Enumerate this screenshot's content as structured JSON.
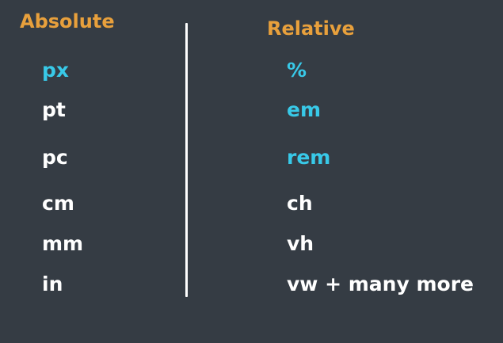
{
  "colors": {
    "background": "#353c44",
    "heading": "#e8a03c",
    "highlight": "#38c9e8",
    "text": "#ffffff"
  },
  "absolute": {
    "title": "Absolute",
    "units": [
      "px",
      "pt",
      "pc",
      "cm",
      "mm",
      "in"
    ],
    "highlighted": [
      "px"
    ]
  },
  "relative": {
    "title": "Relative",
    "units": [
      "%",
      "em",
      "rem",
      "ch",
      "vh",
      "vw + many more"
    ],
    "highlighted": [
      "%",
      "em",
      "rem"
    ]
  }
}
